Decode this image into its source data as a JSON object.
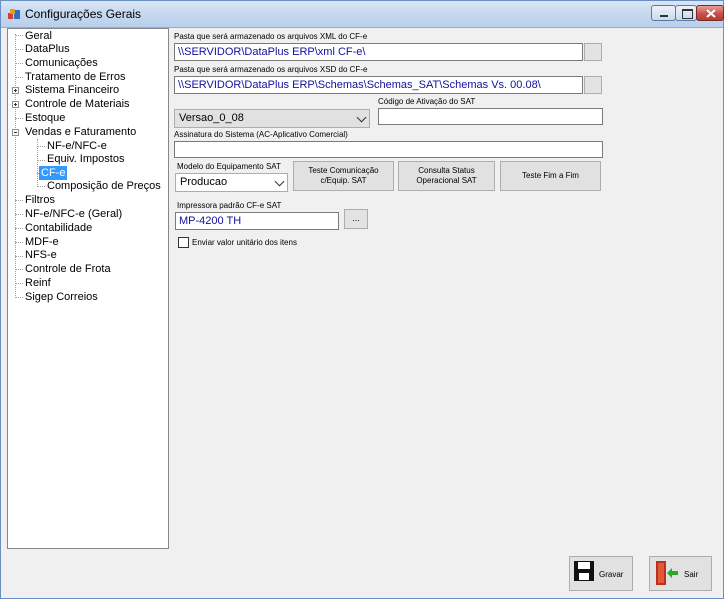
{
  "window": {
    "title": "Configurações Gerais"
  },
  "tree": {
    "items": [
      {
        "label": "Geral"
      },
      {
        "label": "DataPlus"
      },
      {
        "label": "Comunicações"
      },
      {
        "label": "Tratamento de Erros"
      },
      {
        "label": "Sistema Financeiro"
      },
      {
        "label": "Controle de Materiais"
      },
      {
        "label": "Estoque"
      },
      {
        "label": "Vendas e Faturamento"
      },
      {
        "label": "NF-e/NFC-e"
      },
      {
        "label": "Equiv. Impostos"
      },
      {
        "label": "CF-e",
        "selected": true
      },
      {
        "label": "Composição de Preços"
      },
      {
        "label": "Filtros"
      },
      {
        "label": "NF-e/NFC-e (Geral)"
      },
      {
        "label": "Contabilidade"
      },
      {
        "label": "MDF-e"
      },
      {
        "label": "NFS-e"
      },
      {
        "label": "Controle de Frota"
      },
      {
        "label": "Reinf"
      },
      {
        "label": "Sigep Correios"
      }
    ]
  },
  "form": {
    "xml_path_label": "Pasta que será armazenado os arquivos XML do CF-e",
    "xml_path_value": "\\\\SERVIDOR\\DataPlus ERP\\xml CF-e\\",
    "xsd_path_label": "Pasta que será armazenado os arquivos XSD do CF-e",
    "xsd_path_value": "\\\\SERVIDOR\\DataPlus ERP\\Schemas\\Schemas_SAT\\Schemas Vs. 00.08\\",
    "version_value": "Versao_0_08",
    "activation_code_label": "Código de Ativação do SAT",
    "activation_code_value": "",
    "signature_label": "Assinatura do Sistema (AC-Aplicativo Comercial)",
    "signature_value": "",
    "model_label": "Modelo do Equipamento SAT",
    "model_value": "Producao",
    "test_comm_button": "Teste Comunicação c/Equip. SAT",
    "status_button": "Consulta Status Operacional SAT",
    "end_to_end_button": "Teste Fim a Fim",
    "printer_label": "Impressora padrão CF-e SAT",
    "printer_value": "MP-4200 TH",
    "printer_browse": "...",
    "unit_value_checkbox_label": "Enviar valor unitário dos itens",
    "unit_value_checked": false
  },
  "actions": {
    "save_label": "Gravar",
    "exit_label": "Sair"
  },
  "colors": {
    "selection": "#3399ff",
    "path_text": "#1010a0"
  }
}
